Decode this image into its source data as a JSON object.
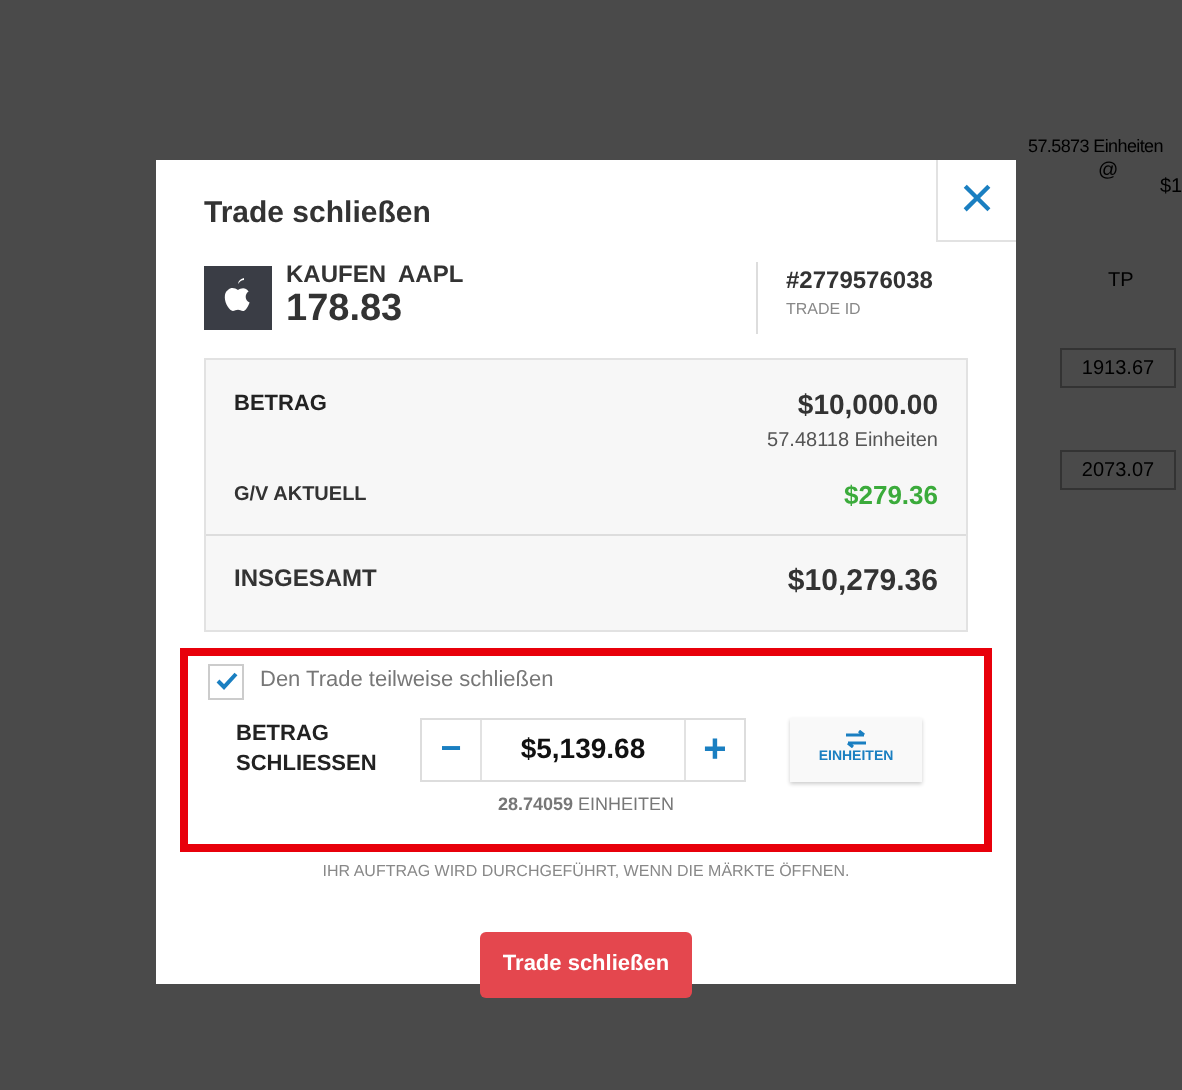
{
  "background": {
    "units": "57.5873 Einheiten",
    "at": "@",
    "price_fragment": "$1",
    "column_tp": "TP",
    "tp_values": [
      "1913.67",
      "2073.07"
    ]
  },
  "dialog": {
    "title": "Trade schließen",
    "close": "×",
    "instrument": {
      "side": "KAUFEN",
      "symbol": "AAPL",
      "price": "178.83"
    },
    "trade_id": {
      "value": "#2779576038",
      "label": "TRADE ID"
    },
    "summary": {
      "amount_label": "BETRAG",
      "amount": "$10,000.00",
      "units": "57.48118 Einheiten",
      "pl_label": "G/V AKTUELL",
      "pl": "$279.36",
      "total_label": "INSGESAMT",
      "total": "$10,279.36"
    },
    "partial": {
      "checked": true,
      "label": "Den Trade teilweise schließen",
      "amount_label": [
        "BETRAG",
        "SCHLIESSEN"
      ],
      "minus": "−",
      "value": "$5,139.68",
      "plus": "+",
      "units_button": "EINHEITEN",
      "units_value": "28.74059",
      "units_suffix": "EINHEITEN",
      "highlighted": true
    },
    "notice": "IHR AUFTRAG WIRD DURCHGEFÜHRT, WENN DIE MÄRKTE ÖFFNEN.",
    "submit": "Trade schließen"
  }
}
